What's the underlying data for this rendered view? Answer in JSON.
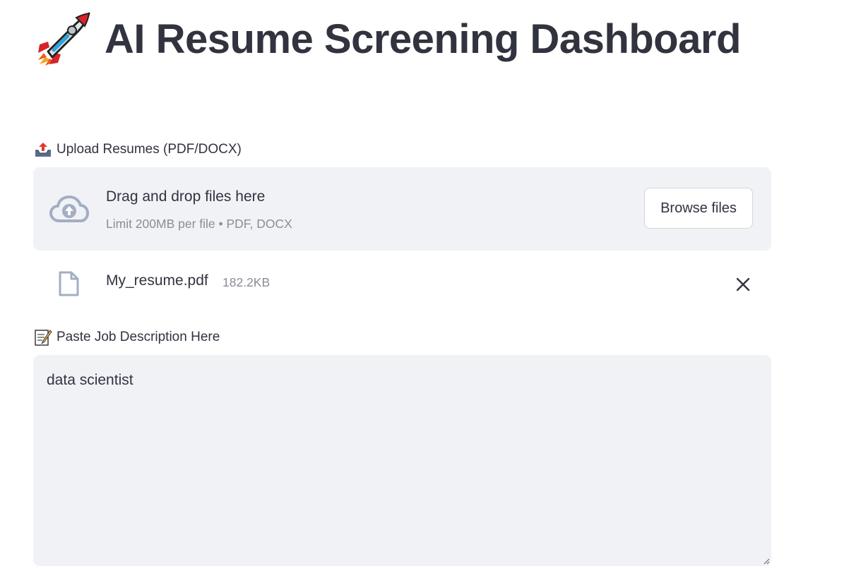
{
  "header": {
    "title": "AI Resume Screening Dashboard",
    "icon": "rocket-icon"
  },
  "upload": {
    "label": "Upload Resumes (PDF/DOCX)",
    "label_icon": "outbox-tray-icon",
    "dropzone_title": "Drag and drop files here",
    "dropzone_subtitle": "Limit 200MB per file • PDF, DOCX",
    "browse_label": "Browse files",
    "uploaded_files": [
      {
        "name": "My_resume.pdf",
        "size": "182.2KB"
      }
    ]
  },
  "job_description": {
    "label": "Paste Job Description Here",
    "label_icon": "memo-icon",
    "value": "data scientist"
  },
  "colors": {
    "text": "#31333f",
    "muted": "#8a8d96",
    "input_bg": "#f0f2f6",
    "icon_blue_gray": "#a3aec2"
  }
}
